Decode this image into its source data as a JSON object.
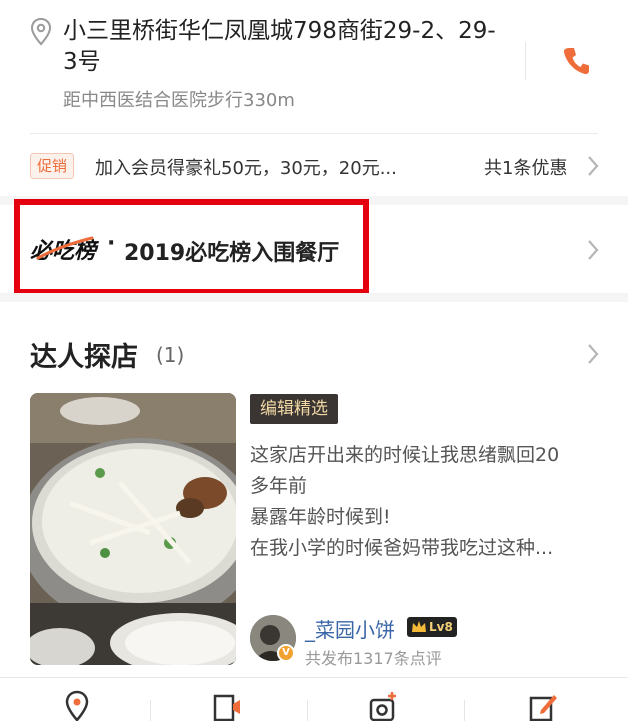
{
  "address": {
    "line": "小三里桥街华仁凤凰城798商街29-2、29-3号",
    "distance": "距中西医结合医院步行330m"
  },
  "promo": {
    "badge": "促销",
    "text": "加入会员得豪礼50元，30元，20元...",
    "count": "共1条优惠"
  },
  "must_eat": {
    "logo_text": "必吃榜",
    "separator": "·",
    "title": "2019必吃榜入围餐厅"
  },
  "daren": {
    "title": "达人探店",
    "count": "(1)",
    "tag": "编辑精选",
    "review_lines": [
      "这家店开出来的时候让我思绪飘回20",
      "多年前",
      "暴露年龄时候到!",
      "在我小学的时候爸妈带我吃过这种..."
    ],
    "user": {
      "name": "_菜园小饼",
      "level": "Lv8",
      "verified": "V",
      "sub": "共发布1317条点评"
    }
  },
  "colors": {
    "accent": "#ef6d3b",
    "highlight_frame": "#e4000f",
    "link_blue": "#3a66a8"
  }
}
